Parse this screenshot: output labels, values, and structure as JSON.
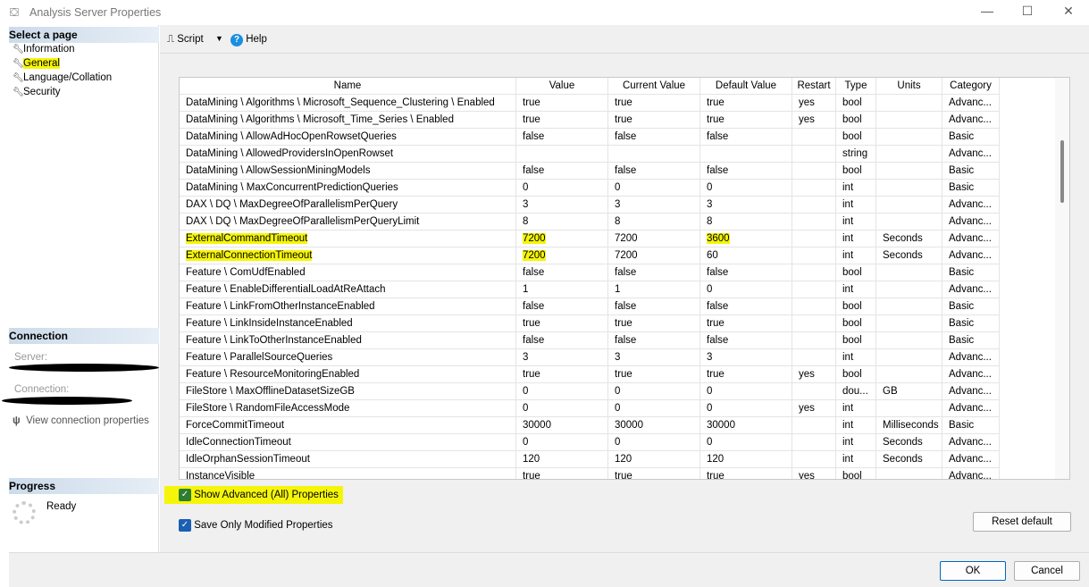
{
  "window": {
    "title": "Analysis Server Properties",
    "minimize": "—",
    "maximize": "☐",
    "close": "✕"
  },
  "sidebar": {
    "select_page": "Select a page",
    "items": [
      {
        "label": "Information"
      },
      {
        "label": "General",
        "highlighted": true
      },
      {
        "label": "Language/Collation"
      },
      {
        "label": "Security"
      }
    ],
    "connection_header": "Connection",
    "server_label": "Server:",
    "connection_label": "Connection:",
    "view_connection": "View connection properties",
    "progress_header": "Progress",
    "progress_status": "Ready"
  },
  "toolbar": {
    "script": "Script",
    "help": "Help"
  },
  "table": {
    "columns": [
      "Name",
      "Value",
      "Current Value",
      "Default Value",
      "Restart",
      "Type",
      "Units",
      "Category"
    ],
    "rows": [
      [
        "DataMining \\ Algorithms \\ Microsoft_Sequence_Clustering \\ Enabled",
        "true",
        "true",
        "true",
        "yes",
        "bool",
        "",
        "Advanc..."
      ],
      [
        "DataMining \\ Algorithms \\ Microsoft_Time_Series \\ Enabled",
        "true",
        "true",
        "true",
        "yes",
        "bool",
        "",
        "Advanc..."
      ],
      [
        "DataMining \\ AllowAdHocOpenRowsetQueries",
        "false",
        "false",
        "false",
        "",
        "bool",
        "",
        "Basic"
      ],
      [
        "DataMining \\ AllowedProvidersInOpenRowset",
        "",
        "",
        "",
        "",
        "string",
        "",
        "Advanc..."
      ],
      [
        "DataMining \\ AllowSessionMiningModels",
        "false",
        "false",
        "false",
        "",
        "bool",
        "",
        "Basic"
      ],
      [
        "DataMining \\ MaxConcurrentPredictionQueries",
        "0",
        "0",
        "0",
        "",
        "int",
        "",
        "Basic"
      ],
      [
        "DAX \\ DQ \\ MaxDegreeOfParallelismPerQuery",
        "3",
        "3",
        "3",
        "",
        "int",
        "",
        "Advanc..."
      ],
      [
        "DAX \\ DQ \\ MaxDegreeOfParallelismPerQueryLimit",
        "8",
        "8",
        "8",
        "",
        "int",
        "",
        "Advanc..."
      ],
      [
        "ExternalCommandTimeout",
        "7200",
        "7200",
        "3600",
        "",
        "int",
        "Seconds",
        "Advanc..."
      ],
      [
        "ExternalConnectionTimeout",
        "7200",
        "7200",
        "60",
        "",
        "int",
        "Seconds",
        "Advanc..."
      ],
      [
        "Feature \\ ComUdfEnabled",
        "false",
        "false",
        "false",
        "",
        "bool",
        "",
        "Basic"
      ],
      [
        "Feature \\ EnableDifferentialLoadAtReAttach",
        "1",
        "1",
        "0",
        "",
        "int",
        "",
        "Advanc..."
      ],
      [
        "Feature \\ LinkFromOtherInstanceEnabled",
        "false",
        "false",
        "false",
        "",
        "bool",
        "",
        "Basic"
      ],
      [
        "Feature \\ LinkInsideInstanceEnabled",
        "true",
        "true",
        "true",
        "",
        "bool",
        "",
        "Basic"
      ],
      [
        "Feature \\ LinkToOtherInstanceEnabled",
        "false",
        "false",
        "false",
        "",
        "bool",
        "",
        "Basic"
      ],
      [
        "Feature \\ ParallelSourceQueries",
        "3",
        "3",
        "3",
        "",
        "int",
        "",
        "Advanc..."
      ],
      [
        "Feature \\ ResourceMonitoringEnabled",
        "true",
        "true",
        "true",
        "yes",
        "bool",
        "",
        "Advanc..."
      ],
      [
        "FileStore \\ MaxOfflineDatasetSizeGB",
        "0",
        "0",
        "0",
        "",
        "dou...",
        "GB",
        "Advanc..."
      ],
      [
        "FileStore \\ RandomFileAccessMode",
        "0",
        "0",
        "0",
        "yes",
        "int",
        "",
        "Advanc..."
      ],
      [
        "ForceCommitTimeout",
        "30000",
        "30000",
        "30000",
        "",
        "int",
        "Milliseconds",
        "Basic"
      ],
      [
        "IdleConnectionTimeout",
        "0",
        "0",
        "0",
        "",
        "int",
        "Seconds",
        "Advanc..."
      ],
      [
        "IdleOrphanSessionTimeout",
        "120",
        "120",
        "120",
        "",
        "int",
        "Seconds",
        "Advanc..."
      ],
      [
        "InstanceVisible",
        "true",
        "true",
        "true",
        "yes",
        "bool",
        "",
        "Advanc..."
      ]
    ],
    "highlights": [
      [
        8,
        0
      ],
      [
        8,
        1
      ],
      [
        8,
        3
      ],
      [
        9,
        0
      ],
      [
        9,
        1
      ]
    ]
  },
  "options": {
    "show_advanced": "Show Advanced (All) Properties",
    "show_advanced_checked": true,
    "save_modified": "Save Only Modified Properties",
    "save_modified_checked": true,
    "reset_default": "Reset default"
  },
  "buttons": {
    "ok": "OK",
    "cancel": "Cancel"
  },
  "colors": {
    "highlight": "#f5f50a",
    "accent": "#1a5fb4"
  }
}
